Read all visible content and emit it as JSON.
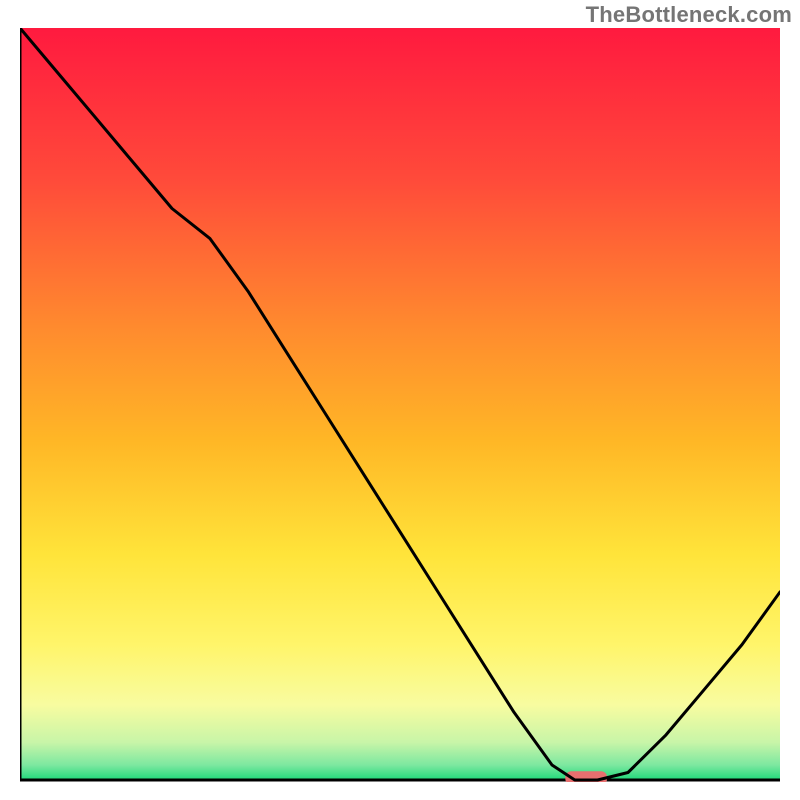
{
  "watermark": "TheBottleneck.com",
  "chart_data": {
    "type": "line",
    "title": "",
    "xlabel": "",
    "ylabel": "",
    "xlim": [
      0,
      100
    ],
    "ylim": [
      0,
      100
    ],
    "grid": false,
    "series": [
      {
        "name": "bottleneck-curve",
        "x": [
          0,
          5,
          10,
          15,
          20,
          25,
          30,
          35,
          40,
          45,
          50,
          55,
          60,
          65,
          70,
          73,
          76,
          80,
          85,
          90,
          95,
          100
        ],
        "y": [
          100,
          94,
          88,
          82,
          76,
          72,
          65,
          57,
          49,
          41,
          33,
          25,
          17,
          9,
          2,
          0,
          0,
          1,
          6,
          12,
          18,
          25
        ]
      }
    ],
    "marker": {
      "name": "optimal-point",
      "x": 74.5,
      "y": 0,
      "width_pct": 5.5,
      "height_pct": 1.8,
      "color": "#e76f6f"
    },
    "background_gradient": {
      "stops": [
        {
          "offset": 0.0,
          "color": "#ff1a3f"
        },
        {
          "offset": 0.2,
          "color": "#ff4a3a"
        },
        {
          "offset": 0.4,
          "color": "#ff8b2e"
        },
        {
          "offset": 0.55,
          "color": "#ffb726"
        },
        {
          "offset": 0.7,
          "color": "#ffe43a"
        },
        {
          "offset": 0.82,
          "color": "#fff56a"
        },
        {
          "offset": 0.9,
          "color": "#f8fca0"
        },
        {
          "offset": 0.95,
          "color": "#c8f5a8"
        },
        {
          "offset": 0.98,
          "color": "#7de8a0"
        },
        {
          "offset": 1.0,
          "color": "#1fd87a"
        }
      ]
    }
  }
}
